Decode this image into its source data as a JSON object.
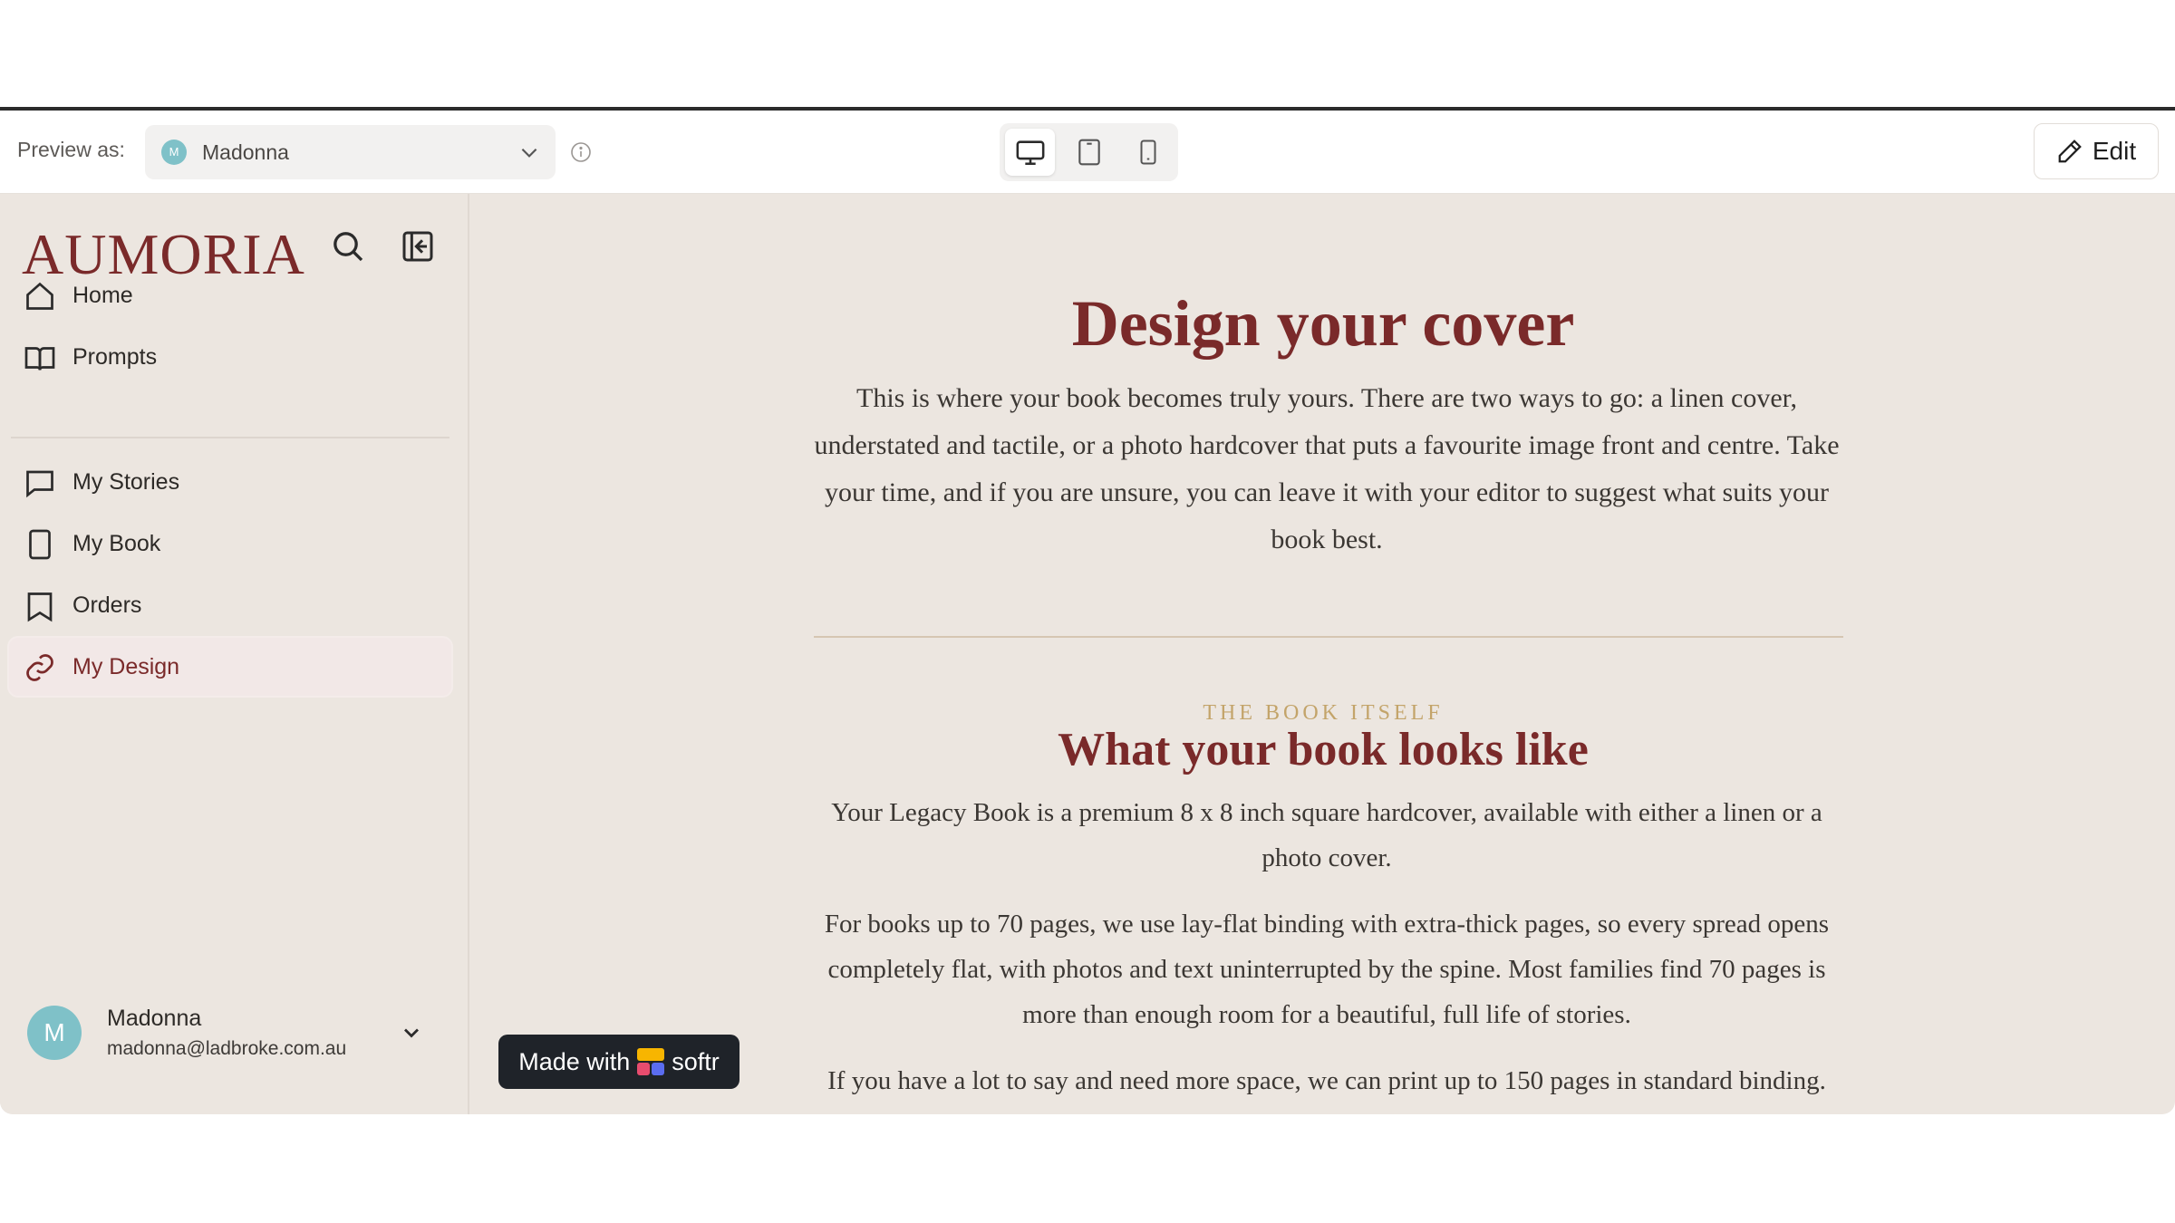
{
  "preview_bar": {
    "label": "Preview as:",
    "selected_user": "Madonna",
    "selected_user_initial": "M",
    "edit_label": "Edit",
    "devices": [
      "desktop-icon",
      "tablet-icon",
      "mobile-icon"
    ],
    "active_device": "desktop"
  },
  "sidebar": {
    "logo": "AUMORIA",
    "items": [
      {
        "label": "Home",
        "icon": "home-icon"
      },
      {
        "label": "Prompts",
        "icon": "book-open-icon"
      },
      {
        "label": "My Stories",
        "icon": "chat-icon"
      },
      {
        "label": "My Book",
        "icon": "book-icon"
      },
      {
        "label": "Orders",
        "icon": "bookmark-icon"
      },
      {
        "label": "My Design",
        "icon": "link-icon"
      }
    ],
    "active_item": "My Design",
    "account": {
      "initial": "M",
      "name": "Madonna",
      "email": "madonna@ladbroke.com.au"
    }
  },
  "badge": {
    "prefix": "Made with",
    "brand": "softr"
  },
  "main": {
    "title": "Design your cover",
    "intro": "This is where your book becomes truly yours. There are two ways to go: a linen cover, understated and tactile, or a photo hardcover that puts a favourite image front and centre. Take your time, and if you are unsure, you can leave it with your editor to suggest what suits your book best.",
    "eyebrow": "THE BOOK ITSELF",
    "section_title": "What your book looks like",
    "paragraphs": [
      "Your Legacy Book is a premium 8 x 8 inch square hardcover, available with either a linen or a photo cover.",
      "For books up to 70 pages, we use lay-flat binding with extra-thick pages, so every spread opens completely flat, with photos and text uninterrupted by the spine. Most families find 70 pages is more than enough room for a beautiful, full life of stories.",
      "If you have a lot to say and need more space, we can print up to 150 pages in standard binding. The"
    ]
  },
  "colors": {
    "brand": "#7a2a2a",
    "background": "#ece6e0",
    "accent_gold": "#c3a46a",
    "avatar": "#7fc1c8"
  }
}
